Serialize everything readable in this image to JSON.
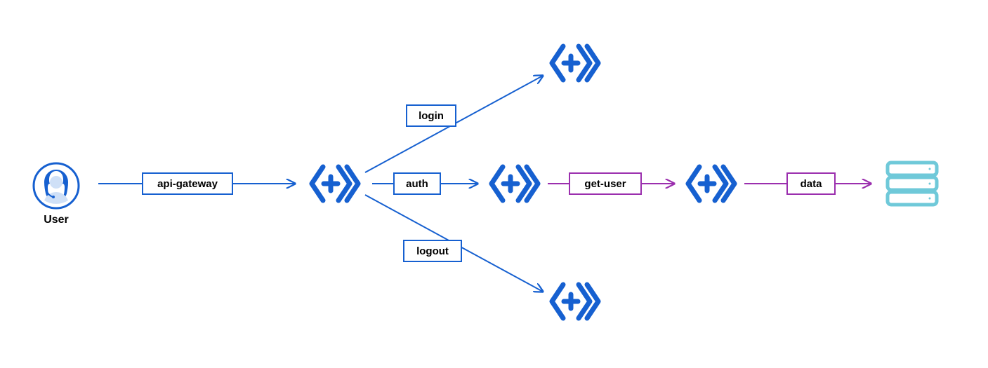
{
  "colors": {
    "blue": "#1660d0",
    "purple": "#9b2fae",
    "teal": "#6fc9d9",
    "black": "#000000"
  },
  "nodes": {
    "user_caption": "User"
  },
  "edges": {
    "api_gateway": "api-gateway",
    "login": "login",
    "auth": "auth",
    "logout": "logout",
    "get_user": "get-user",
    "data": "data"
  }
}
